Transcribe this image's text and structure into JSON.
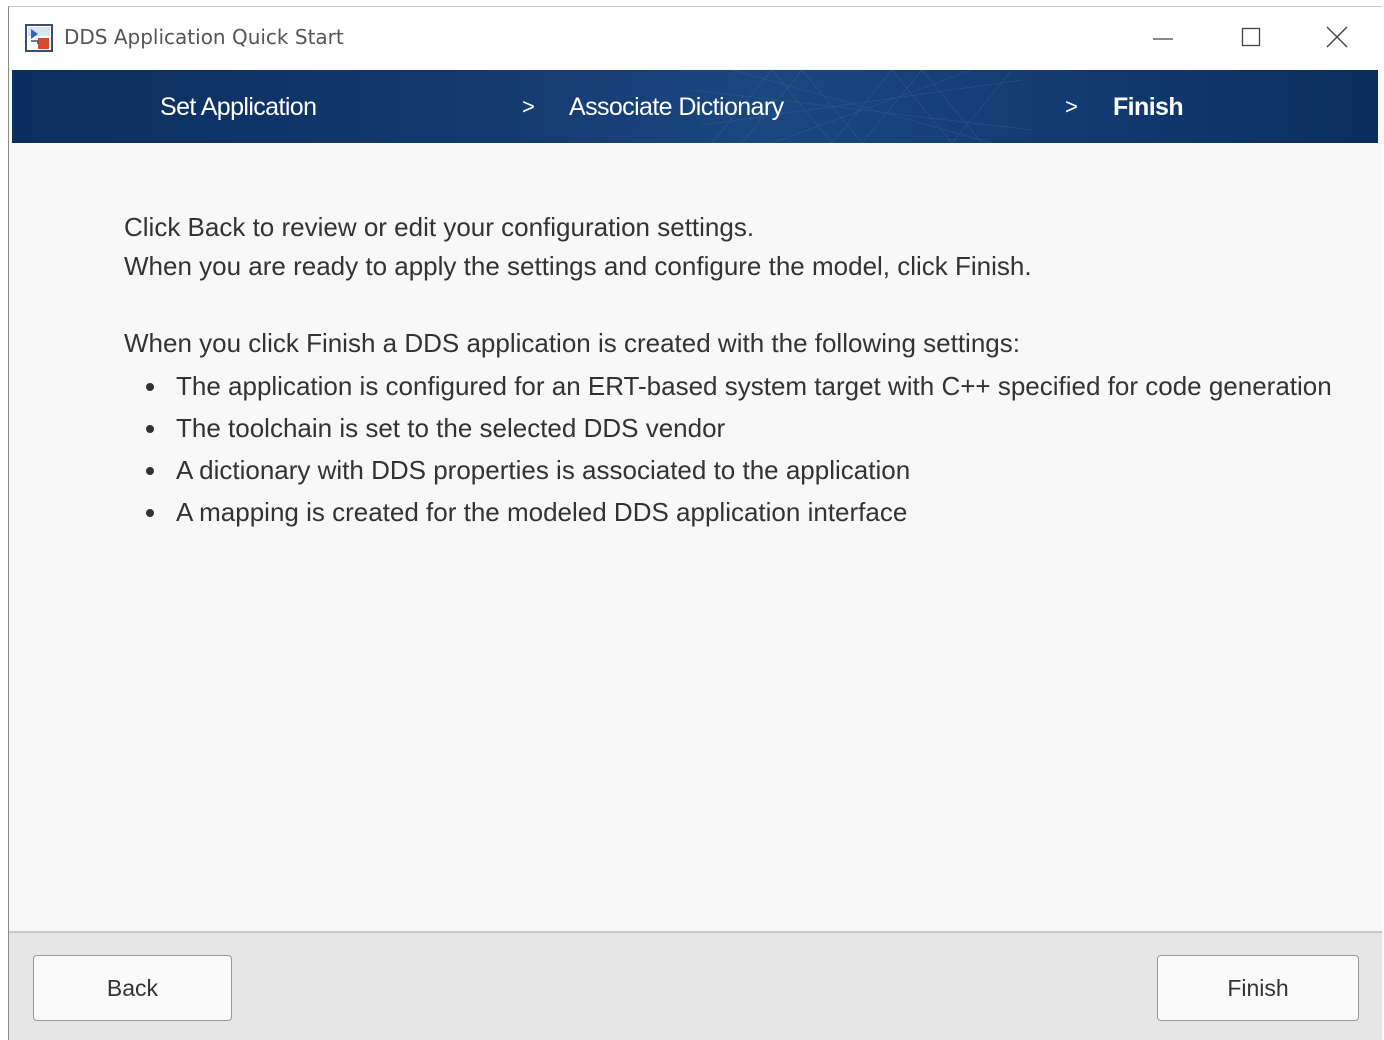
{
  "window": {
    "title": "DDS Application Quick Start",
    "icon": "simulink-app-icon"
  },
  "titlebar_controls": {
    "minimize_icon": "minimize-icon",
    "maximize_icon": "maximize-icon",
    "close_icon": "close-icon"
  },
  "steps": {
    "items": [
      {
        "label": "Set Application",
        "current": false
      },
      {
        "label": "Associate Dictionary",
        "current": false
      },
      {
        "label": "Finish",
        "current": true
      }
    ],
    "separator": ">"
  },
  "content": {
    "intro_line_1": "Click Back to review or edit your configuration settings.",
    "intro_line_2": "When you are ready to apply the settings and configure the model, click Finish.",
    "summary_heading": "When you click Finish a DDS application is created with the following settings:",
    "bullets": [
      "The application is configured for an ERT-based system target with C++ specified for code generation",
      "The toolchain is set to the selected DDS vendor",
      "A dictionary with DDS properties is associated to the application",
      "A mapping is created for the modeled DDS application interface"
    ]
  },
  "footer": {
    "back_label": "Back",
    "finish_label": "Finish"
  },
  "colors": {
    "banner": "#13386d",
    "body_text": "#333333",
    "footer_bg": "#e6e6e6"
  }
}
